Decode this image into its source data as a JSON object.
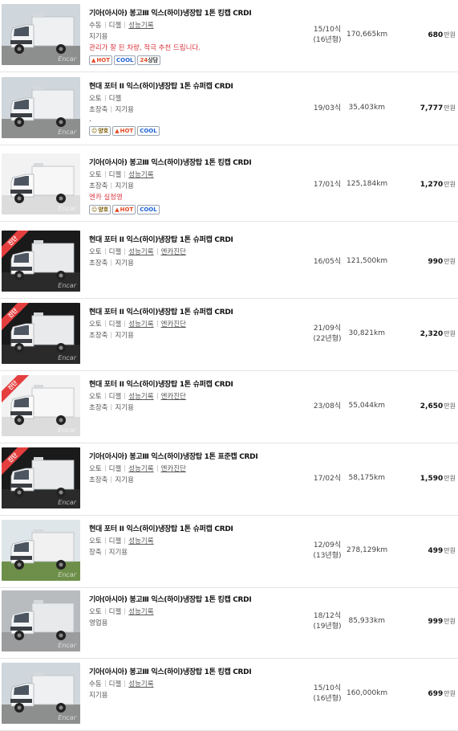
{
  "listings": [
    {
      "title": "기아(아시아) 봉고Ⅲ 익스(하이)냉장탑 1톤 킹캡 CRDI",
      "transmission": "수동",
      "fuel": "디젤",
      "record": "성능기록",
      "diagnosis": "",
      "region": [
        "지기용"
      ],
      "note": "관리가 잘 된 차량, 적극 추천 드립니다.",
      "tags": [
        {
          "type": "hot",
          "label": "HOT",
          "icon": "fire-icon"
        },
        {
          "type": "cool",
          "label": "COOL"
        },
        {
          "type": "24",
          "num": "24",
          "label": "상담"
        }
      ],
      "year": "15/10식",
      "year2": "(16년형)",
      "km": "170,665km",
      "price": "680",
      "unit": "만원",
      "photo": "ext",
      "ribbon": false
    },
    {
      "title": "현대 포터 II 익스(하이)냉장탑 1톤 슈퍼캡 CRDI",
      "transmission": "오토",
      "fuel": "디젤",
      "record": "",
      "diagnosis": "",
      "region": [
        "초장축",
        "지기용"
      ],
      "note": "",
      "dot": ".",
      "tags": [
        {
          "type": "yang",
          "label": "양호",
          "icon": "smile-icon"
        },
        {
          "type": "hot",
          "label": "HOT",
          "icon": "fire-icon"
        },
        {
          "type": "cool",
          "label": "COOL"
        }
      ],
      "year": "19/03식",
      "year2": "",
      "km": "35,403km",
      "price": "7,777",
      "unit": "만원",
      "photo": "ext",
      "ribbon": false
    },
    {
      "title": "기아(아시아) 봉고Ⅲ 익스(하이)냉장탑 1톤 킹캡 CRDI",
      "transmission": "오토",
      "fuel": "디젤",
      "record": "성능기록",
      "diagnosis": "",
      "region": [
        "초장축",
        "지기용"
      ],
      "note": "엔카 실청영",
      "tags": [
        {
          "type": "yang",
          "label": "양호",
          "icon": "smile-icon"
        },
        {
          "type": "hot",
          "label": "HOT",
          "icon": "fire-icon"
        },
        {
          "type": "cool",
          "label": "COOL"
        }
      ],
      "year": "17/01식",
      "year2": "",
      "km": "125,184km",
      "price": "1,270",
      "unit": "만원",
      "photo": "studio",
      "ribbon": false
    },
    {
      "title": "현대 포터 II 익스(하이)냉장탑 1톤 슈퍼캡 CRDI",
      "transmission": "오토",
      "fuel": "디젤",
      "record": "성능기록",
      "diagnosis": "엔카진단",
      "region": [
        "초장축",
        "지기용"
      ],
      "note": "",
      "tags": [],
      "year": "16/05식",
      "year2": "",
      "km": "121,500km",
      "price": "990",
      "unit": "만원",
      "photo": "dark",
      "ribbon": true,
      "ribbon_text": "진단"
    },
    {
      "title": "현대 포터 II 익스(하이)냉장탑 1톤 슈퍼캡 CRDI",
      "transmission": "오토",
      "fuel": "디젤",
      "record": "성능기록",
      "diagnosis": "엔카진단",
      "region": [
        "초장축",
        "지기용"
      ],
      "note": "",
      "tags": [],
      "year": "21/09식",
      "year2": "(22년형)",
      "km": "30,821km",
      "price": "2,320",
      "unit": "만원",
      "photo": "dark",
      "ribbon": true,
      "ribbon_text": "진단"
    },
    {
      "title": "현대 포터 II 익스(하이)냉장탑 1톤 슈퍼캡 CRDI",
      "transmission": "오토",
      "fuel": "디젤",
      "record": "성능기록",
      "diagnosis": "엔카진단",
      "region": [
        "초장축",
        "지기용"
      ],
      "note": "",
      "tags": [],
      "year": "23/08식",
      "year2": "",
      "km": "55,044km",
      "price": "2,650",
      "unit": "만원",
      "photo": "studio",
      "ribbon": true,
      "ribbon_text": "진단"
    },
    {
      "title": "기아(아시아) 봉고Ⅲ 익스(하이)냉장탑 1톤 표준캡 CRDI",
      "transmission": "오토",
      "fuel": "디젤",
      "record": "성능기록",
      "diagnosis": "엔카진단",
      "region": [
        "초장축",
        "지기용"
      ],
      "note": "",
      "tags": [],
      "year": "17/02식",
      "year2": "",
      "km": "58,175km",
      "price": "1,590",
      "unit": "만원",
      "photo": "dark",
      "ribbon": true,
      "ribbon_text": "진단"
    },
    {
      "title": "현대 포터 II 익스(하이)냉장탑 1톤 슈퍼캡 CRDI",
      "transmission": "오토",
      "fuel": "디젤",
      "record": "성능기록",
      "diagnosis": "",
      "region": [
        "장축",
        "지기용"
      ],
      "note": "",
      "tags": [],
      "year": "12/09식",
      "year2": "(13년형)",
      "km": "278,129km",
      "price": "499",
      "unit": "만원",
      "photo": "green",
      "ribbon": false
    },
    {
      "title": "기아(아시아) 봉고Ⅲ 익스(하이)냉장탑 1톤 킹캡 CRDI",
      "transmission": "오토",
      "fuel": "디젤",
      "record": "성능기록",
      "diagnosis": "",
      "region": [
        "영업용"
      ],
      "note": "",
      "tags": [],
      "year": "18/12식",
      "year2": "(19년형)",
      "km": "85,933km",
      "price": "999",
      "unit": "만원",
      "photo": "lot",
      "ribbon": false
    },
    {
      "title": "기아(아시아) 봉고Ⅲ 익스(하이)냉장탑 1톤 킹캡 CRDI",
      "transmission": "수동",
      "fuel": "디젤",
      "record": "성능기록",
      "diagnosis": "",
      "region": [
        "지기용"
      ],
      "note": "",
      "tags": [],
      "year": "15/10식",
      "year2": "(16년형)",
      "km": "160,000km",
      "price": "699",
      "unit": "만원",
      "photo": "ext",
      "ribbon": false
    }
  ],
  "watermark": "Encar"
}
